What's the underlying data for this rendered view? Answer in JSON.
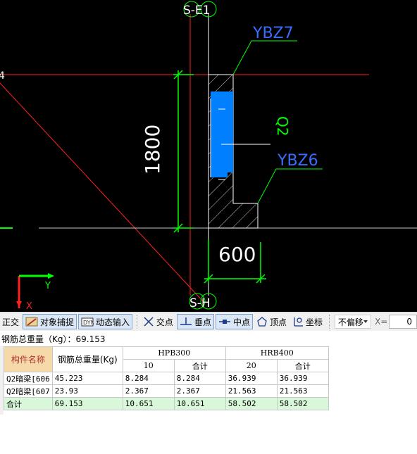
{
  "drawing": {
    "axis_top_label": "S-E1",
    "axis_bottom_label": "S-H",
    "label_ybz7": "YBZ7",
    "label_ybz6": "YBZ6",
    "label_q2": "Q2",
    "dim_vertical": "1800",
    "dim_horizontal": "600",
    "ucs_y": "Y",
    "ucs_x": "X",
    "left_edge_mark": "4"
  },
  "toolbar": {
    "ortho": "正交",
    "snap": "对象捕捉",
    "dynamic_input": "动态输入",
    "intersection": "交点",
    "perpendicular": "垂点",
    "midpoint": "中点",
    "vertex": "顶点",
    "coordinate": "坐标",
    "offset_mode": "不偏移",
    "x_label": "X=",
    "x_value": "0"
  },
  "summary": {
    "text": "钢筋总重量（Kg）：69.153"
  },
  "table": {
    "col_component": "构件名称",
    "col_total_weight": "钢筋总重量(Kg)",
    "group_hpb": "HPB300",
    "group_hrb": "HRB400",
    "sub_hpb_d": "10",
    "sub_hpb_total": "合计",
    "sub_hrb_d": "20",
    "sub_hrb_total": "合计",
    "rows": [
      {
        "name": "Q2暗梁[606",
        "weight": "45.223",
        "hpb10": "8.284",
        "hpb_total": "8.284",
        "hrb20": "36.939",
        "hrb_total": "36.939"
      },
      {
        "name": "Q2暗梁[607",
        "weight": "23.93",
        "hpb10": "2.367",
        "hpb_total": "2.367",
        "hrb20": "21.563",
        "hrb_total": "21.563"
      },
      {
        "name": "合计",
        "weight": "69.153",
        "hpb10": "10.651",
        "hpb_total": "10.651",
        "hrb20": "58.502",
        "hrb_total": "58.502"
      }
    ]
  },
  "colors": {
    "cad_background": "#000000",
    "wall_fill": "#0080ff",
    "dimension": "#00ff00",
    "axis_red": "#ff2020",
    "label_blue": "#3a6cff",
    "total_row": "#d9f7d9",
    "header_key": "#f6d9a8"
  }
}
